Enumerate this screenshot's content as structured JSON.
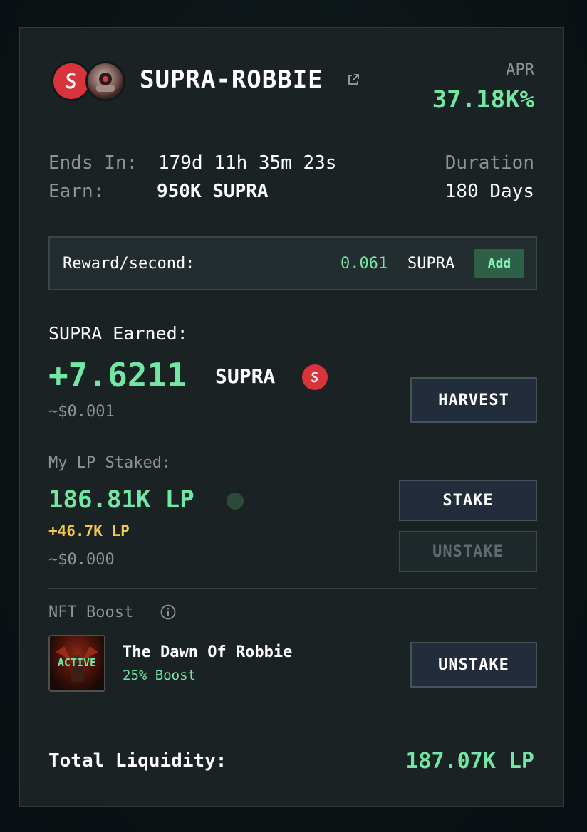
{
  "header": {
    "pool_name": "SUPRA-ROBBIE",
    "apr_label": "APR",
    "apr_value": "37.18K%"
  },
  "info": {
    "ends_label": "Ends In:",
    "ends_value": "179d 11h 35m 23s",
    "earn_label": "Earn:",
    "earn_value": "950K SUPRA",
    "duration_label": "Duration",
    "duration_value": "180 Days"
  },
  "reward": {
    "label": "Reward/second:",
    "value": "0.061",
    "unit": "SUPRA",
    "add_label": "Add"
  },
  "earned": {
    "label": "SUPRA Earned:",
    "amount": "+7.6211",
    "unit": "SUPRA",
    "usd": "~$0.001",
    "harvest_label": "HARVEST"
  },
  "staked": {
    "label": "My LP Staked:",
    "amount": "186.81K LP",
    "bonus": "+46.7K LP",
    "usd": "~$0.000",
    "stake_label": "STAKE",
    "unstake_label": "UNSTAKE"
  },
  "nft": {
    "label": "NFT Boost",
    "badge": "ACTIVE",
    "name": "The Dawn Of Robbie",
    "boost": "25% Boost",
    "unstake_label": "UNSTAKE"
  },
  "total": {
    "label": "Total Liquidity:",
    "value": "187.07K LP"
  },
  "colors": {
    "accent_green": "#72e7a4",
    "bonus_yellow": "#f2c94c",
    "supra_red": "#d9343d"
  }
}
